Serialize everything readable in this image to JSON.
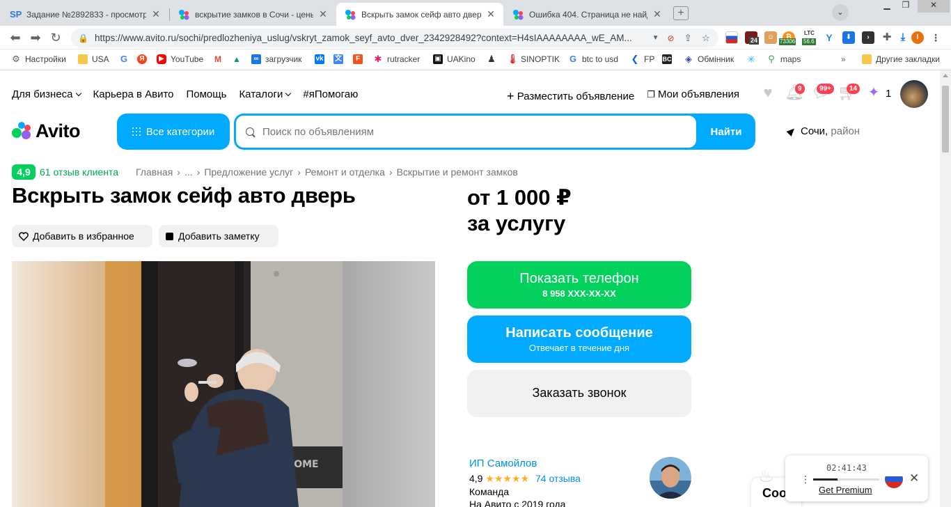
{
  "browser": {
    "tabs": [
      {
        "favicon": "SP",
        "title": "Задание №2892833 - просмотр з"
      },
      {
        "favicon": "avito-dots",
        "title": "вскрытие замков в Сочи - цены"
      },
      {
        "favicon": "avito-dots",
        "title": "Вскрыть замок сейф авто дверь"
      },
      {
        "favicon": "avito-dots",
        "title": "Ошибка 404. Страница не найде"
      }
    ],
    "url": "https://www.avito.ru/sochi/predlozheniya_uslug/vskryt_zamok_seyf_avto_dver_2342928492?context=H4sIAAAAAAAA_wE_AM...",
    "extensions": {
      "badge_24": "24",
      "btc_price": "73306",
      "ltc_label": "LTC",
      "ltc_price": "56.6"
    },
    "bookmarks": [
      {
        "label": "Настройки",
        "icon": "gear-icon"
      },
      {
        "label": "USA",
        "icon": "folder-icon"
      },
      {
        "label": "",
        "icon": "google-icon"
      },
      {
        "label": "",
        "icon": "yandex-icon"
      },
      {
        "label": "YouTube",
        "icon": "youtube-icon"
      },
      {
        "label": "",
        "icon": "gmail-icon"
      },
      {
        "label": "",
        "icon": "drive-icon"
      },
      {
        "label": "загрузчик",
        "icon": "loop-icon"
      },
      {
        "label": "",
        "icon": "vk-icon"
      },
      {
        "label": "",
        "icon": "translate-icon"
      },
      {
        "label": "",
        "icon": "f-icon"
      },
      {
        "label": "rutracker",
        "icon": "rutracker-icon"
      },
      {
        "label": "UAKino",
        "icon": "uakino-icon"
      },
      {
        "label": "",
        "icon": "person-icon"
      },
      {
        "label": "SINOPTIK",
        "icon": "thermometer-icon"
      },
      {
        "label": "btc to usd",
        "icon": "google-icon"
      },
      {
        "label": "FP",
        "icon": "fp-icon"
      },
      {
        "label": "",
        "icon": "bc-icon"
      },
      {
        "label": "Обмінник",
        "icon": "diamond-icon"
      },
      {
        "label": "",
        "icon": "snowflake-icon"
      },
      {
        "label": "maps",
        "icon": "maps-pin-icon"
      }
    ],
    "bookmarks_overflow": "»",
    "other_bookmarks": "Другие закладки"
  },
  "header": {
    "nav": [
      "Для бизнеса",
      "Карьера в Авито",
      "Помощь",
      "Каталоги",
      "#яПомогаю"
    ],
    "post_ad": "Разместить объявление",
    "my_ads": "Мои объявления",
    "badges": {
      "notifications": "9",
      "messages": "99+",
      "cart": "14",
      "bonus": "1"
    },
    "logo_text": "Avito",
    "all_categories": "Все категории",
    "search_placeholder": "Поиск по объявлениям",
    "search_button": "Найти",
    "city": "Сочи,",
    "region": "район"
  },
  "listing": {
    "rating": "4,9",
    "reviews": "61 отзыв клиента",
    "breadcrumbs": [
      "Главная",
      "...",
      "Предложение услуг",
      "Ремонт и отделка",
      "Вскрытие и ремонт замков"
    ],
    "breadcrumb_separator": "›",
    "title": "Вскрыть замок сейф авто дверь",
    "add_favorite": "Добавить в избранное",
    "add_note": "Добавить заметку",
    "price_line1": "от 1 000 ₽",
    "price_line2": "за услугу",
    "show_phone": "Показать телефон",
    "phone_masked": "8 958 XXX-XX-XX",
    "write_message": "Написать сообщение",
    "reply_time": "Отвечает в течение дня",
    "order_call": "Заказать звонок",
    "photo_mat_text": "LCOME"
  },
  "seller": {
    "name": "ИП Самойлов",
    "rating": "4,9",
    "stars": "★★★★★",
    "reviews": "74 отзыва",
    "type": "Команда",
    "since": "На Авито с 2019 года"
  },
  "overlay": {
    "chat_partial": "Соо",
    "timer": "02:41:43",
    "progress": 0.37,
    "premium": "Get Premium",
    "more": "⋮",
    "close": "✕"
  },
  "colors": {
    "avito_blue": "#00aaff",
    "avito_green": "#02d15c",
    "link_blue": "#0091e6",
    "badge_red": "#ff4053",
    "gray_button": "#f2f1f0"
  }
}
